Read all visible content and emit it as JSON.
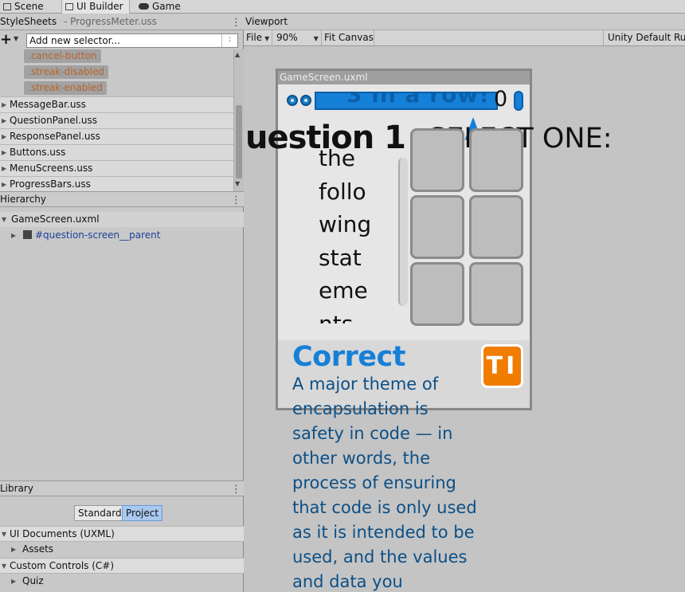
{
  "tabs": [
    {
      "label": "Scene",
      "icon": "grid-icon"
    },
    {
      "label": "UI Builder",
      "icon": "ui-builder-icon"
    },
    {
      "label": "Game",
      "icon": "gamepad-icon"
    }
  ],
  "stylesheets": {
    "title": "StyleSheets",
    "subtitle": "-  ProgressMeter.uss",
    "selector_placeholder": "Add new selector...",
    "selectors": [
      ".cancel-button",
      ".streak-disabled",
      ".streak-enabled"
    ],
    "files": [
      "MessageBar.uss",
      "QuestionPanel.uss",
      "ResponsePanel.uss",
      "Buttons.uss",
      "MenuScreens.uss",
      "ProgressBars.uss"
    ]
  },
  "hierarchy": {
    "title": "Hierarchy",
    "root": "GameScreen.uxml",
    "child": "#question-screen__parent"
  },
  "library": {
    "title": "Library",
    "tabs": {
      "standard": "Standard",
      "project": "Project"
    },
    "sections": [
      {
        "label": "UI Documents (UXML)",
        "child": "Assets"
      },
      {
        "label": "Custom Controls (C#)",
        "child": "Quiz"
      }
    ]
  },
  "viewport": {
    "title": "Viewport",
    "toolbar": {
      "file": "File",
      "zoom": "90%",
      "fit": "Fit Canvas",
      "theme": "Unity Default Run"
    }
  },
  "game_screen": {
    "title": "GameScreen.uxml",
    "meter_text": "3 in a row!",
    "counter": "0",
    "question_title": "uestion 1",
    "select_title": "SELECT ONE:",
    "question_lines": [
      "the",
      "follo",
      "wing",
      "stat",
      "eme",
      "nts"
    ],
    "result": "Correct",
    "explanation": "A major theme of encapsulation is safety in code — in other words, the process of ensuring that code is only used as it is intended to be used, and the values and data you",
    "badge": "TI"
  },
  "colors": {
    "accent": "#1580d8",
    "explanation": "#0c4f86",
    "badge": "#f07c00",
    "selector_text": "#b8642a"
  }
}
